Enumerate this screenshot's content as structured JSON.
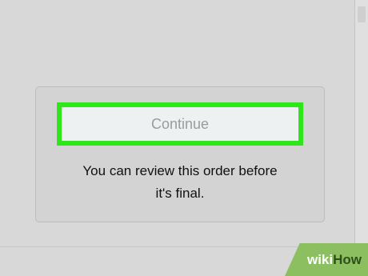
{
  "dialog": {
    "button_label": "Continue",
    "note_line_1": "You can review this order before",
    "note_line_2": "it's final."
  },
  "watermark": {
    "part_1": "wiki",
    "part_2": "How"
  },
  "colors": {
    "highlight": "#2ee61a",
    "button_text": "#9b9b9b",
    "background": "#d9d9d9"
  }
}
